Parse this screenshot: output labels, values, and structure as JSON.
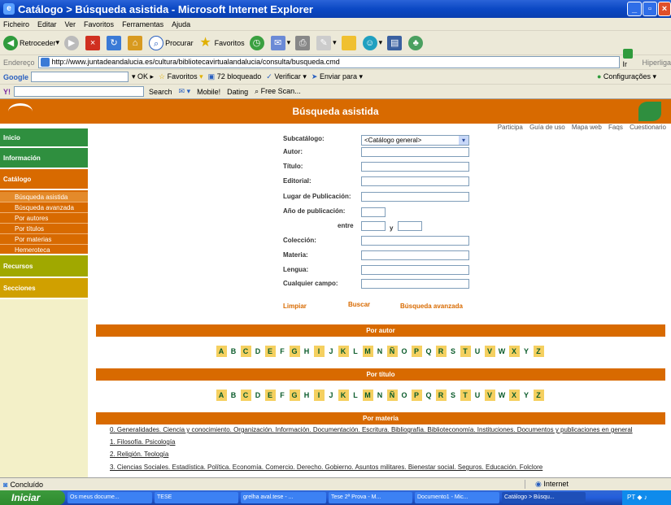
{
  "window": {
    "title": "Catálogo > Búsqueda asistida - Microsoft Internet Explorer"
  },
  "menu": [
    "Ficheiro",
    "Editar",
    "Ver",
    "Favoritos",
    "Ferramentas",
    "Ajuda"
  ],
  "toolbar": {
    "back": "Retroceder",
    "search": "Procurar",
    "favorites": "Favoritos"
  },
  "address": {
    "label": "Endereço",
    "url": "http://www.juntadeandalucia.es/cultura/bibliotecavirtualandalucia/consulta/busqueda.cmd",
    "go": "Ir para",
    "links": "Hiperligações"
  },
  "google": {
    "label": "Google",
    "favoritos": "Favoritos",
    "blocked": "72 bloqueado",
    "verify": "Verificar",
    "send": "Enviar para",
    "config": "Configurações"
  },
  "ybar": {
    "search": "Search",
    "mobile": "Mobile!",
    "dating": "Dating",
    "freescan": "Free Scan..."
  },
  "page": {
    "banner": "Búsqueda asistida",
    "toplinks": [
      "Participa",
      "Guía de uso",
      "Mapa web",
      "Faqs",
      "Cuestionario"
    ],
    "nav": [
      {
        "label": "Inicio",
        "color": "#2f8f3f"
      },
      {
        "label": "Información",
        "color": "#2f8f3f"
      },
      {
        "label": "Catálogo",
        "color": "#d86a00"
      }
    ],
    "subnav": [
      "Búsqueda asistida",
      "Búsqueda avanzada",
      "Por autores",
      "Por títulos",
      "Por materias",
      "Hemeroteca"
    ],
    "nav2": [
      {
        "label": "Recursos",
        "color": "#a0a800"
      },
      {
        "label": "Secciones",
        "color": "#d0a000"
      }
    ],
    "form": {
      "subcatalogo_label": "Subcatálogo:",
      "subcatalogo_value": "<Catálogo general>",
      "autor": "Autor:",
      "titulo": "Título:",
      "editorial": "Editorial:",
      "lugar": "Lugar de Publicación:",
      "anio": "Año de publicación:",
      "entre": "entre",
      "y": "y",
      "coleccion": "Colección:",
      "materia": "Materia:",
      "lengua": "Lengua:",
      "cualquier": "Cualquier campo:",
      "limpiar": "Limpiar",
      "buscar": "Buscar",
      "avanzada": "Búsqueda avanzada"
    },
    "por_autor": "Por autor",
    "por_titulo": "Por título",
    "por_materia": "Por materia",
    "letters": [
      "A",
      "B",
      "C",
      "D",
      "E",
      "F",
      "G",
      "H",
      "I",
      "J",
      "K",
      "L",
      "M",
      "N",
      "Ñ",
      "O",
      "P",
      "Q",
      "R",
      "S",
      "T",
      "U",
      "V",
      "W",
      "X",
      "Y",
      "Z"
    ],
    "materias": [
      "0. Generalidades. Ciencia y conocimiento. Organización. Información. Documentación. Escritura. Bibliografía. Biblioteconomía. Instituciones. Documentos y publicaciones en general",
      "1. Filosofía. Psicología",
      "2. Religión. Teología",
      "3. Ciencias Sociales. Estadística. Política. Economía. Comercio. Derecho. Gobierno. Asuntos militares. Bienestar social. Seguros. Educación. Folclore"
    ]
  },
  "status": {
    "left": "Concluído",
    "zone": "Internet"
  },
  "taskbar": {
    "start": "Iniciar",
    "tasks": [
      "Os meus docume...",
      "TESE",
      "grelha aval.tese - ...",
      "Tese 2ª Prova - M...",
      "Documento1 - Mic...",
      "Catálogo > Búsqu..."
    ],
    "tray": "PT"
  }
}
